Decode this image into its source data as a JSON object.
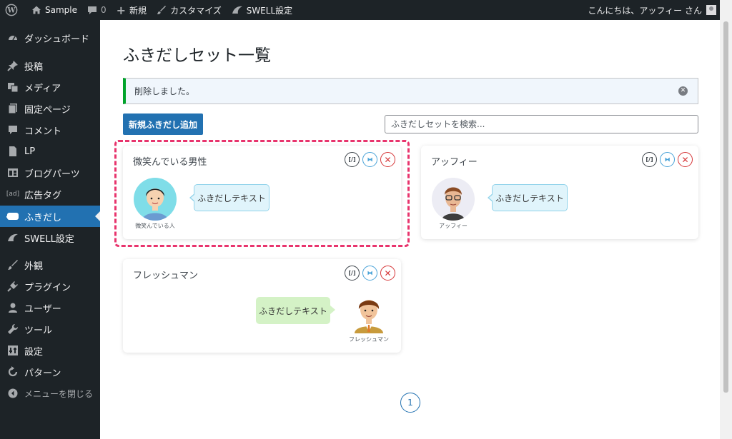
{
  "adminbar": {
    "site_name": "Sample",
    "comments_count": "0",
    "new_label": "新規",
    "customize_label": "カスタマイズ",
    "swell_label": "SWELL設定",
    "greeting": "こんにちは、アッフィー さん"
  },
  "sidebar": {
    "items": [
      {
        "label": "ダッシュボード",
        "icon": "dashboard-icon"
      },
      {
        "label": "投稿",
        "icon": "pin-icon"
      },
      {
        "label": "メディア",
        "icon": "media-icon"
      },
      {
        "label": "固定ページ",
        "icon": "page-icon"
      },
      {
        "label": "コメント",
        "icon": "comment-icon"
      },
      {
        "label": "LP",
        "icon": "document-icon"
      },
      {
        "label": "ブログパーツ",
        "icon": "layout-icon"
      },
      {
        "label": "広告タグ",
        "icon": "ad-icon"
      },
      {
        "label": "ふきだし",
        "icon": "speech-bubble-icon"
      },
      {
        "label": "SWELL設定",
        "icon": "swell-icon"
      },
      {
        "label": "外観",
        "icon": "paintbrush-icon"
      },
      {
        "label": "プラグイン",
        "icon": "plugin-icon"
      },
      {
        "label": "ユーザー",
        "icon": "user-icon"
      },
      {
        "label": "ツール",
        "icon": "wrench-icon"
      },
      {
        "label": "設定",
        "icon": "settings-icon"
      },
      {
        "label": "パターン",
        "icon": "pattern-icon"
      },
      {
        "label": "メニューを閉じる",
        "icon": "collapse-icon"
      }
    ],
    "current": "ふきだし"
  },
  "main": {
    "title": "ふきだしセット一覧",
    "notice": "削除しました。",
    "add_button": "新規ふきだし追加",
    "search_placeholder": "ふきだしセットを検索...",
    "pagination_current": "1"
  },
  "cards": [
    {
      "title": "微笑んでいる男性",
      "avatar_name": "微笑んでいる人",
      "bubble": "ふきだしテキスト",
      "bubble_color": "blue",
      "side": "left"
    },
    {
      "title": "アッフィー",
      "avatar_name": "アッフィー",
      "bubble": "ふきだしテキスト",
      "bubble_color": "blue",
      "side": "left"
    },
    {
      "title": "フレッシュマン",
      "avatar_name": "フレッシュマン",
      "bubble": "ふきだしテキスト",
      "bubble_color": "green",
      "side": "right"
    }
  ],
  "card_actions": {
    "copy": "[/]",
    "duplicate": "⧓",
    "delete": "✕"
  },
  "colors": {
    "accent": "#2271b1",
    "highlight": "#e8346d",
    "notice_border": "#00a32a"
  }
}
